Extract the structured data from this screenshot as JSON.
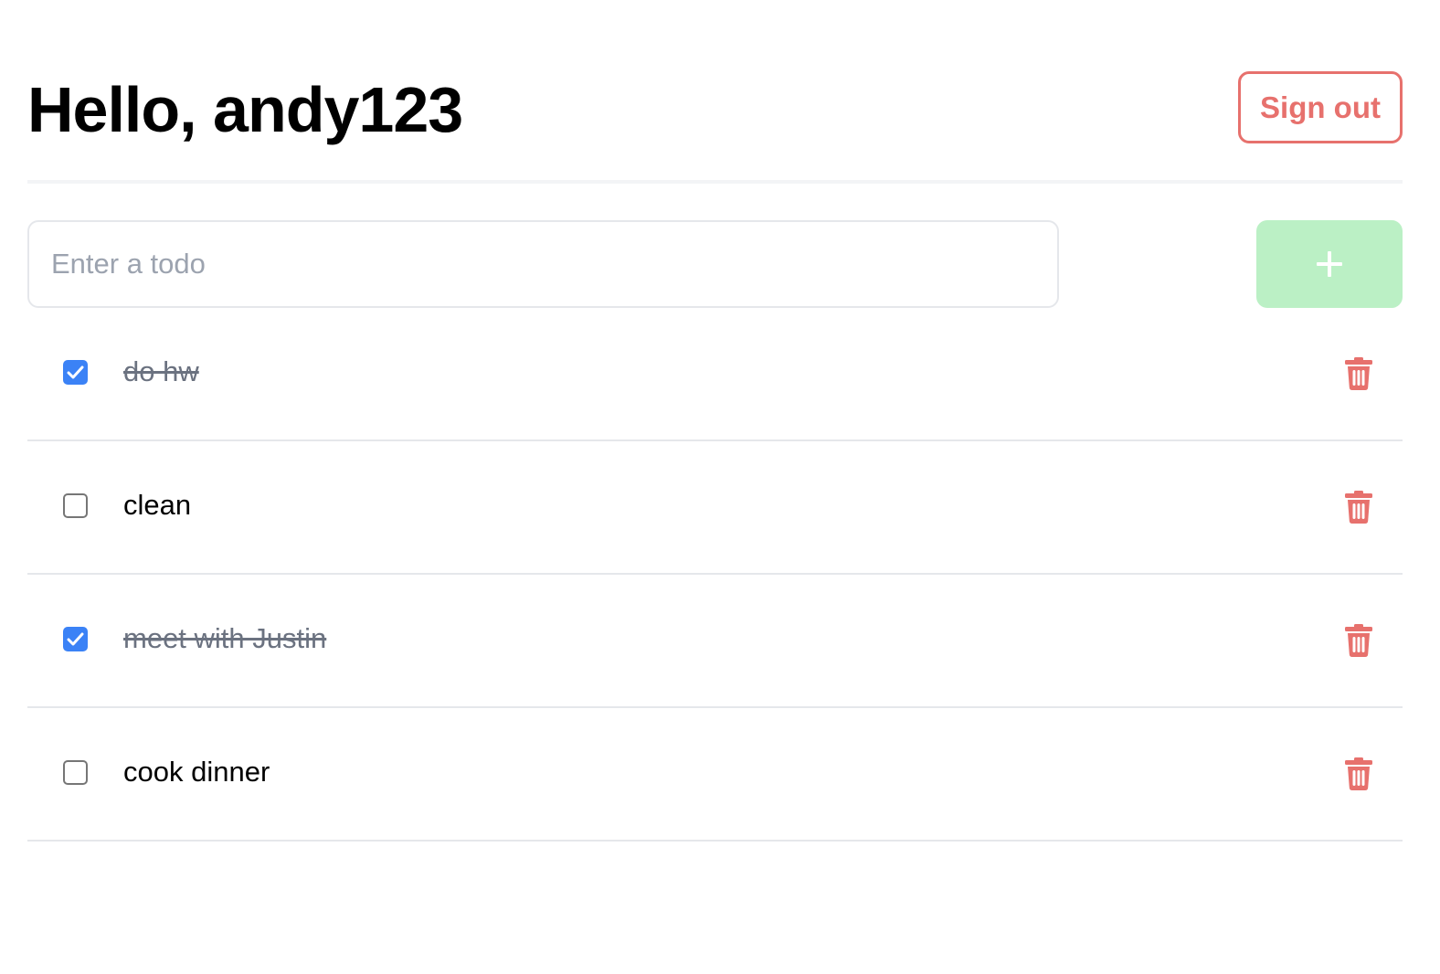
{
  "header": {
    "greeting": "Hello, andy123",
    "sign_out_label": "Sign out"
  },
  "add_todo": {
    "input_value": "",
    "input_placeholder": "Enter a todo",
    "add_button_icon": "plus-icon"
  },
  "todos": [
    {
      "text": "do hw",
      "completed": true
    },
    {
      "text": "clean",
      "completed": false
    },
    {
      "text": "meet with Justin",
      "completed": true
    },
    {
      "text": "cook dinner",
      "completed": false
    }
  ],
  "icons": {
    "delete": "trash-icon",
    "checkbox_checked": "check-icon"
  },
  "colors": {
    "accent_red": "#e7716d",
    "add_button_bg": "#bbf0c5",
    "checkbox_blue": "#3b82f6",
    "completed_text": "#6b7280"
  }
}
